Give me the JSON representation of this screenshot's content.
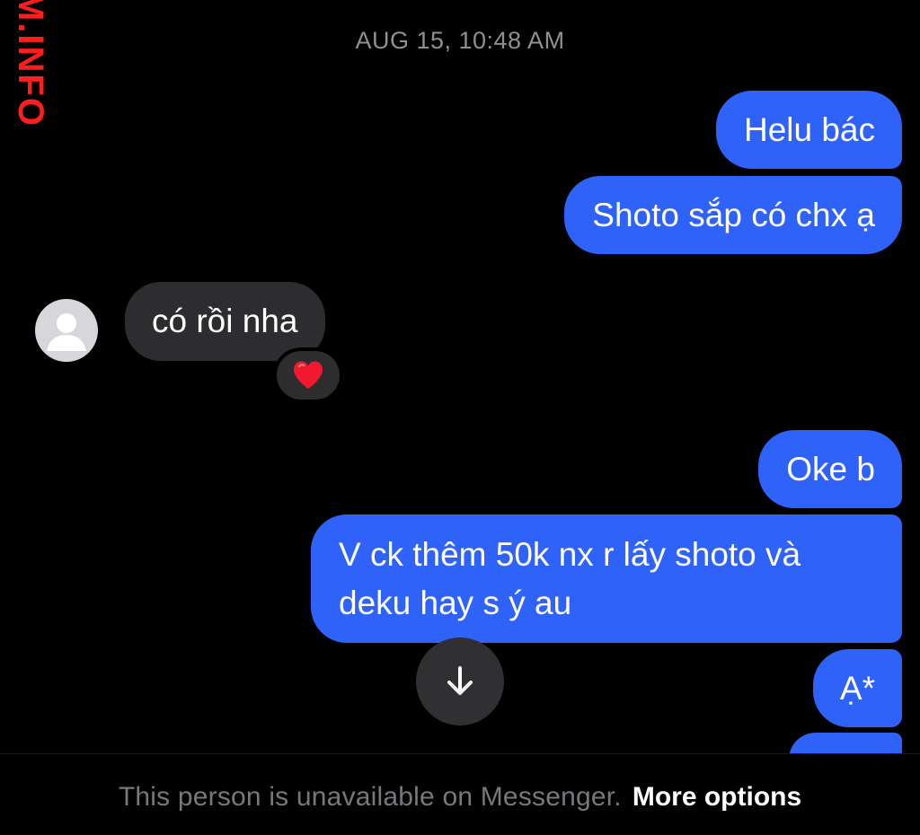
{
  "watermark": {
    "text": "M.INFO",
    "color": "#ff1e1e"
  },
  "conversation": {
    "timestamp": "AUG 15, 10:48 AM",
    "messages": [
      {
        "direction": "outgoing",
        "text": "Helu bác"
      },
      {
        "direction": "outgoing",
        "text": "Shoto sắp có chx ạ"
      },
      {
        "direction": "incoming",
        "text": "có rồi nha",
        "reaction": "heart"
      },
      {
        "direction": "outgoing",
        "text": "Oke b"
      },
      {
        "direction": "outgoing",
        "text": "V ck thêm 50k nx r lấy shoto và deku hay s ý au"
      },
      {
        "direction": "outgoing",
        "text": "Ạ*"
      },
      {
        "direction": "outgoing",
        "text": ""
      }
    ],
    "avatar_icon": "default-profile-avatar-icon",
    "reaction_icon": "red-heart-icon",
    "scroll_button_icon": "arrow-down-icon"
  },
  "footer": {
    "notice": "This person is unavailable on Messenger.",
    "more_options": "More options"
  },
  "colors": {
    "background": "#000000",
    "outgoing_bubble": "#2f62f8",
    "incoming_bubble": "#2d2d30",
    "timestamp": "#8e8e93",
    "footer_notice": "#77777c",
    "reaction_heart": "#f0192f"
  }
}
